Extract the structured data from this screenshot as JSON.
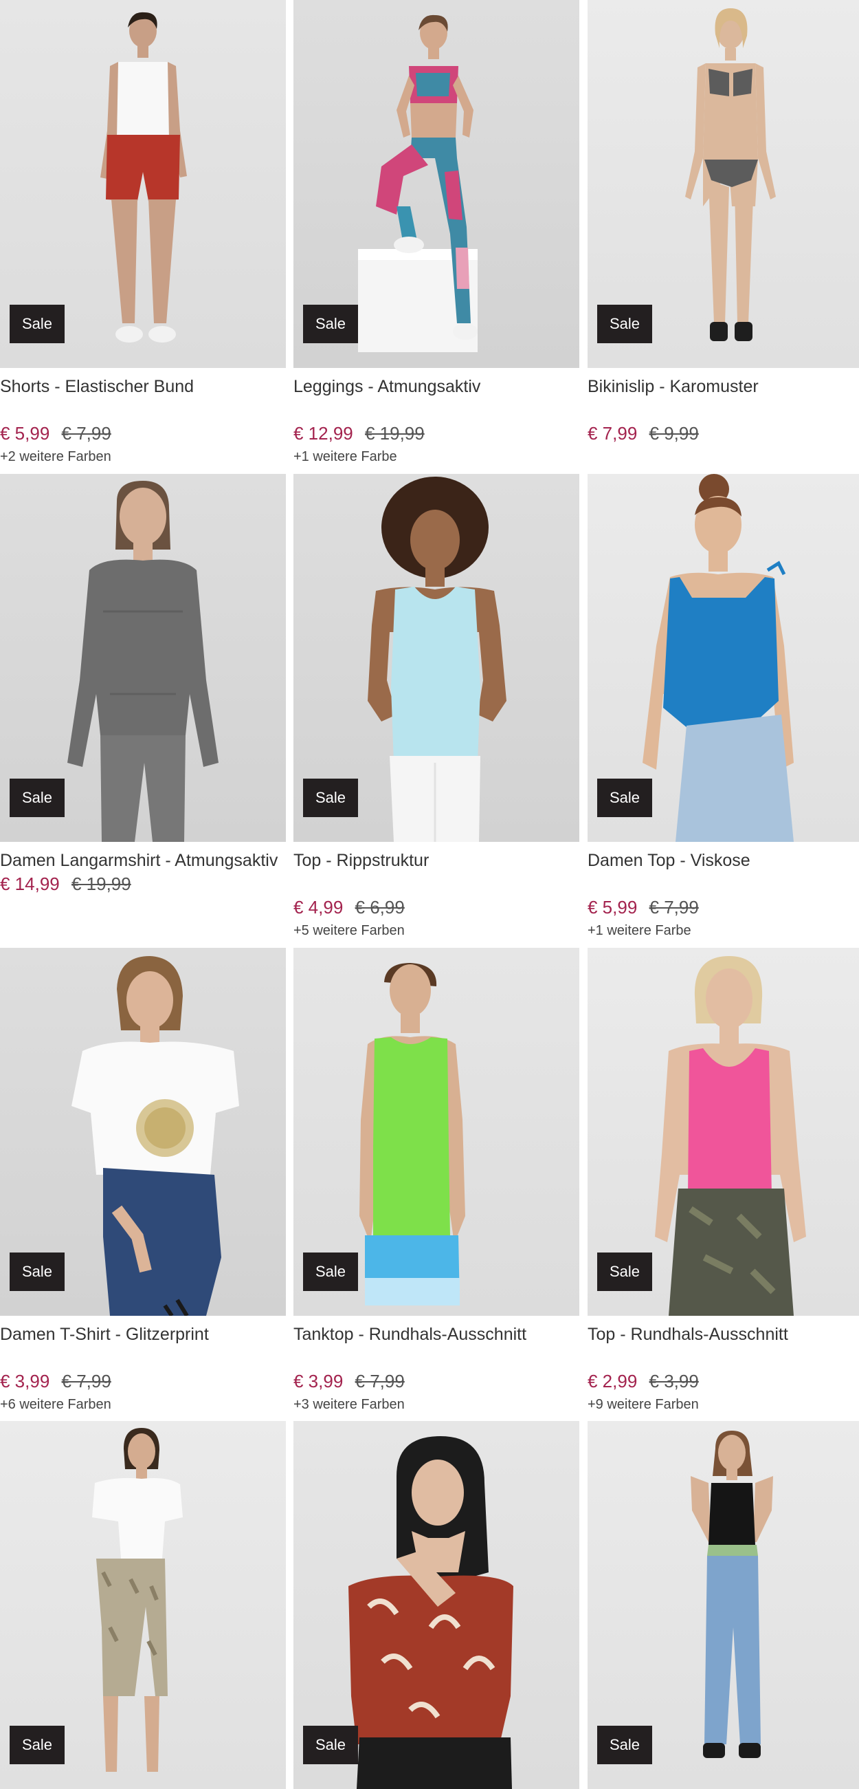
{
  "badge_label": "Sale",
  "colors": {
    "sale_price": "#a3234e",
    "badge_bg": "#231f20"
  },
  "products": [
    {
      "title": "Shorts - Elastischer Bund",
      "price": "€ 5,99",
      "old_price": "€ 7,99",
      "more_colors": "+2 weitere Farben",
      "image": "model-red-shorts-white-tank"
    },
    {
      "title": "Leggings - Atmungsaktiv",
      "price": "€ 12,99",
      "old_price": "€ 19,99",
      "more_colors": "+1 weitere Farbe",
      "image": "model-floral-leggings-sports-bra"
    },
    {
      "title": "Bikinislip - Karomuster",
      "price": "€ 7,99",
      "old_price": "€ 9,99",
      "more_colors": "",
      "image": "model-checked-bikini"
    },
    {
      "title": "Damen Langarmshirt - Atmungsaktiv",
      "price": "€ 14,99",
      "old_price": "€ 19,99",
      "more_colors": "",
      "image": "model-grey-longsleeve"
    },
    {
      "title": "Top - Rippstruktur",
      "price": "€ 4,99",
      "old_price": "€ 6,99",
      "more_colors": "+5 weitere Farben",
      "image": "model-lightblue-ribbed-top"
    },
    {
      "title": "Damen Top - Viskose",
      "price": "€ 5,99",
      "old_price": "€ 7,99",
      "more_colors": "+1 weitere Farbe",
      "image": "model-blue-viscose-top"
    },
    {
      "title": "Damen T-Shirt - Glitzerprint",
      "price": "€ 3,99",
      "old_price": "€ 7,99",
      "more_colors": "+6 weitere Farben",
      "image": "model-white-glitter-tshirt"
    },
    {
      "title": "Tanktop - Rundhals-Ausschnitt",
      "price": "€ 3,99",
      "old_price": "€ 7,99",
      "more_colors": "+3 weitere Farben",
      "image": "model-green-tanktop"
    },
    {
      "title": "Top - Rundhals-Ausschnitt",
      "price": "€ 2,99",
      "old_price": "€ 3,99",
      "more_colors": "+9 weitere Farben",
      "image": "model-pink-top-camo-pants"
    },
    {
      "title": "",
      "price": "",
      "old_price": "",
      "more_colors": "",
      "image": "model-white-tee-leopard-leggings"
    },
    {
      "title": "",
      "price": "",
      "old_price": "",
      "more_colors": "",
      "image": "model-red-print-blouse"
    },
    {
      "title": "",
      "price": "",
      "old_price": "",
      "more_colors": "",
      "image": "model-black-tank-jeans"
    }
  ]
}
